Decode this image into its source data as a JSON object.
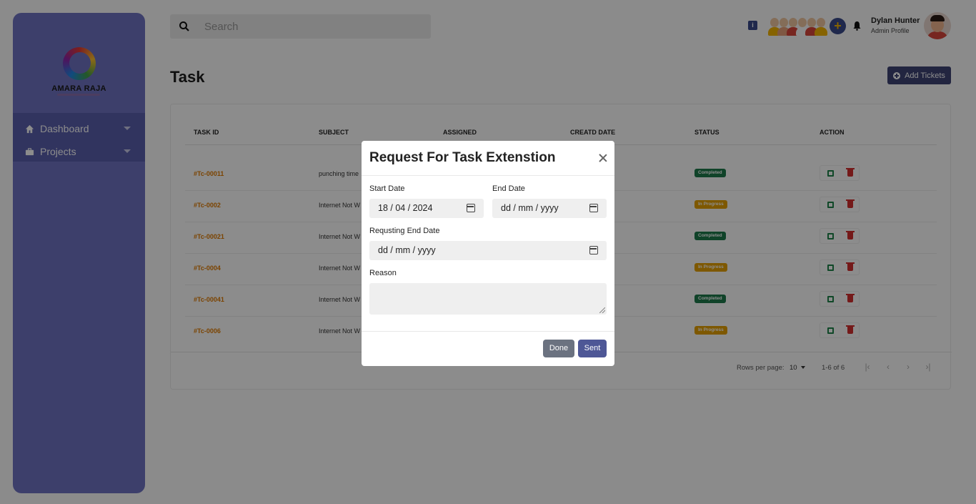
{
  "sidebar": {
    "brand": "AMARA RAJA",
    "items": [
      {
        "label": "Dashboard",
        "icon": "home-icon"
      },
      {
        "label": "Projects",
        "icon": "briefcase-icon"
      }
    ]
  },
  "header": {
    "search_placeholder": "Search",
    "user_name": "Dylan Hunter",
    "user_role": "Admin Profile"
  },
  "page": {
    "title": "Task",
    "add_button": "Add Tickets"
  },
  "table": {
    "columns": [
      "TASK ID",
      "SUBJECT",
      "ASSIGNED",
      "CREATD DATE",
      "STATUS",
      "ACTION"
    ],
    "rows": [
      {
        "id": "#Tc-00011",
        "subject": "punching time",
        "status": "Completed"
      },
      {
        "id": "#Tc-0002",
        "subject": "Internet Not W",
        "status": "In Progress"
      },
      {
        "id": "#Tc-00021",
        "subject": "Internet Not W",
        "status": "Completed"
      },
      {
        "id": "#Tc-0004",
        "subject": "Internet Not W",
        "status": "In Progress"
      },
      {
        "id": "#Tc-00041",
        "subject": "Internet Not W",
        "status": "Completed"
      },
      {
        "id": "#Tc-0006",
        "subject": "Internet Not W",
        "status": "In Progress"
      }
    ],
    "rows_per_page_label": "Rows per page:",
    "rows_per_page": "10",
    "range": "1-6 of 6"
  },
  "colors": {
    "completed": "#1e7a4c",
    "in_progress": "#e6a100",
    "sidebar": "#6f74c4"
  },
  "modal": {
    "title": "Request For Task Extenstion",
    "start_date_label": "Start Date",
    "start_date_value": "18 / 04 / 2024",
    "end_date_label": "End Date",
    "end_date_placeholder": "dd / mm / yyyy",
    "req_end_label": "Requsting End Date",
    "req_end_placeholder": "dd / mm / yyyy",
    "reason_label": "Reason",
    "done_label": "Done",
    "sent_label": "Sent"
  }
}
